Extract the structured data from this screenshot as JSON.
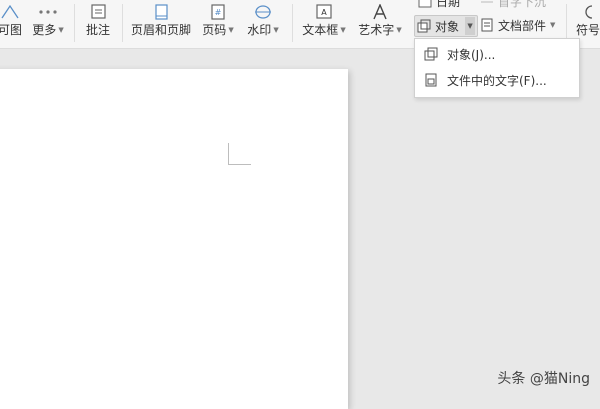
{
  "ribbon": {
    "buttons": [
      {
        "label": "可图",
        "icon": "shapes-icon"
      },
      {
        "label": "更多",
        "icon": "more-dots-icon"
      },
      {
        "label": "批注",
        "icon": "comment-icon"
      },
      {
        "label": "页眉和页脚",
        "icon": "header-footer-icon"
      },
      {
        "label": "页码",
        "icon": "page-number-icon"
      },
      {
        "label": "水印",
        "icon": "watermark-icon"
      },
      {
        "label": "文本框",
        "icon": "textbox-icon"
      },
      {
        "label": "艺术字",
        "icon": "wordart-icon"
      },
      {
        "label": "符号",
        "icon": "symbol-icon"
      }
    ],
    "date_label": "日期",
    "dropcap_label": "首字下沉",
    "object_label": "对象",
    "docparts_label": "文档部件"
  },
  "object_menu": {
    "items": [
      {
        "label": "对象(J)...",
        "icon": "object-icon"
      },
      {
        "label": "文件中的文字(F)...",
        "icon": "text-from-file-icon"
      }
    ]
  },
  "watermark_text": "头条 @猫Ning"
}
